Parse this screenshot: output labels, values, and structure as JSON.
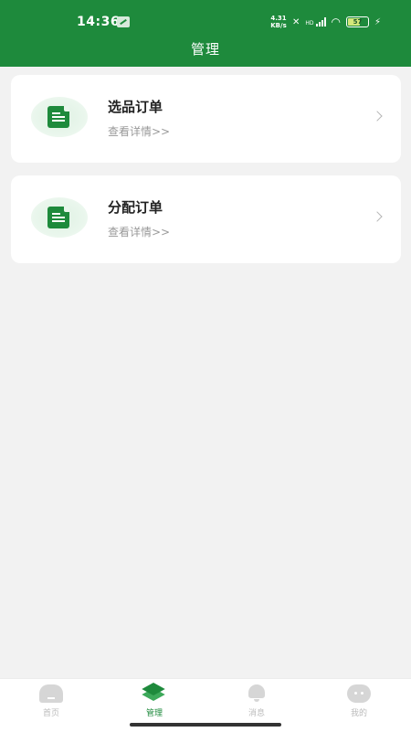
{
  "status_bar": {
    "time": "14:36",
    "net_speed_value": "4.31",
    "net_speed_unit": "KB/s",
    "signal_label": "HD",
    "battery": "57"
  },
  "header": {
    "title": "管理"
  },
  "cards": [
    {
      "title": "选品订单",
      "subtitle": "查看详情>>",
      "icon": "document-icon"
    },
    {
      "title": "分配订单",
      "subtitle": "查看详情>>",
      "icon": "document-icon"
    }
  ],
  "tabbar": {
    "active": "管理",
    "items": [
      {
        "label": "首页",
        "icon": "home-icon"
      },
      {
        "label": "管理",
        "icon": "layers-icon"
      },
      {
        "label": "消息",
        "icon": "bell-icon"
      },
      {
        "label": "我的",
        "icon": "face-icon"
      }
    ]
  },
  "colors": {
    "brand": "#1e8a3c",
    "background": "#f2f2f2",
    "inactive": "#bbbbbb"
  }
}
